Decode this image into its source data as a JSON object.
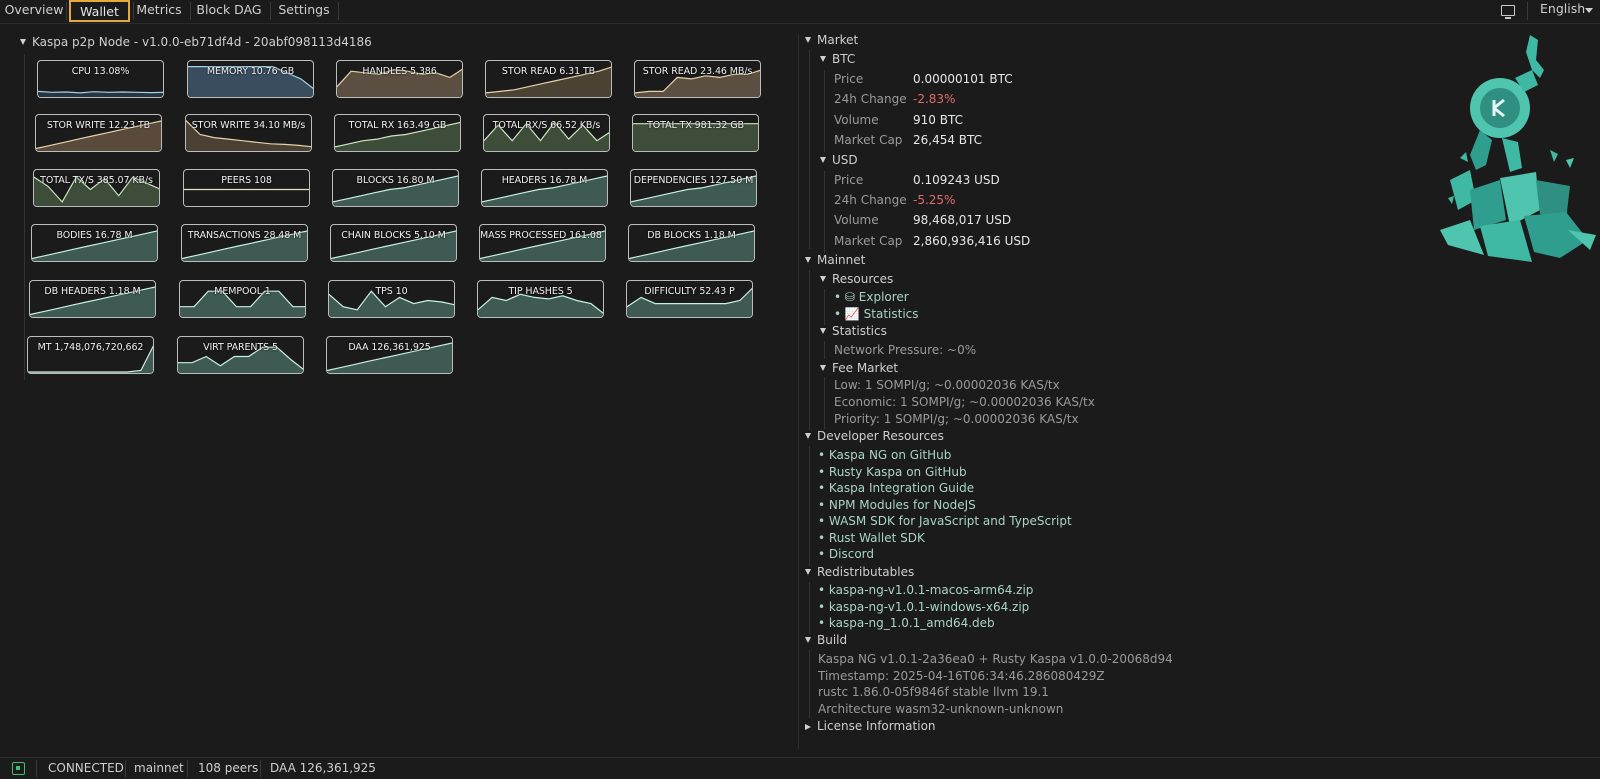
{
  "tabs": [
    {
      "label": "Overview",
      "active": false
    },
    {
      "label": "Wallet",
      "active": true
    },
    {
      "label": "Metrics",
      "active": false
    },
    {
      "label": "Block DAG",
      "active": false
    },
    {
      "label": "Settings",
      "active": false
    }
  ],
  "language": "English",
  "node_title": "Kaspa p2p Node - v1.0.0-eb71df4d - 20abf098113d4186",
  "metrics": [
    {
      "label": "CPU 13.08%",
      "fill": "#253640",
      "stroke": "#9fd2e8",
      "values": [
        0.15,
        0.12,
        0.13,
        0.1,
        0.14,
        0.12,
        0.13,
        0.12,
        0.11,
        0.12
      ]
    },
    {
      "label": "MEMORY 10.76 GB",
      "fill": "#3a4d5e",
      "stroke": "#9fd2e8",
      "values": [
        0.95,
        0.95,
        0.95,
        0.95,
        0.95,
        0.95,
        0.95,
        0.75,
        0.55,
        0.2
      ]
    },
    {
      "label": "HANDLES 5,386",
      "fill": "#5a4f40",
      "stroke": "#e8d2a8",
      "values": [
        0.3,
        0.8,
        0.75,
        0.7,
        0.85,
        0.8,
        0.7,
        0.75,
        0.6,
        0.9
      ]
    },
    {
      "label": "STOR READ 6.31 TB",
      "fill": "#4a4334",
      "stroke": "#e8d2a8",
      "values": [
        0.1,
        0.15,
        0.2,
        0.3,
        0.4,
        0.5,
        0.6,
        0.7,
        0.8,
        0.95
      ]
    },
    {
      "label": "STOR READ 23.46 MB/s",
      "fill": "#5a4f40",
      "stroke": "#e8d2a8",
      "values": [
        0.1,
        0.15,
        0.15,
        0.6,
        0.55,
        0.65,
        0.6,
        0.7,
        0.7,
        0.85
      ]
    },
    {
      "label": "STOR WRITE 12.23 TB",
      "fill": "#5a4a3c",
      "stroke": "#e8d2a8",
      "values": [
        0.05,
        0.15,
        0.25,
        0.35,
        0.45,
        0.55,
        0.65,
        0.75,
        0.85,
        0.95
      ]
    },
    {
      "label": "STOR WRITE 34.10 MB/s",
      "fill": "#4a4034",
      "stroke": "#e8d2a8",
      "values": [
        0.95,
        0.5,
        0.4,
        0.35,
        0.3,
        0.25,
        0.2,
        0.18,
        0.15,
        0.1
      ]
    },
    {
      "label": "TOTAL RX 163.49 GB",
      "fill": "#3e4d3a",
      "stroke": "#c8e8c0",
      "values": [
        0.1,
        0.2,
        0.3,
        0.35,
        0.45,
        0.5,
        0.6,
        0.7,
        0.8,
        0.9
      ]
    },
    {
      "label": "TOTAL RX/S 66.52 KB/s",
      "fill": "#3e4d3a",
      "stroke": "#c8e8c0",
      "values": [
        0.3,
        0.8,
        0.3,
        0.85,
        0.3,
        0.9,
        0.35,
        0.8,
        0.3,
        0.6
      ]
    },
    {
      "label": "TOTAL TX 981.32 GB",
      "fill": "#3e4d3a",
      "stroke": "#c8e8c0",
      "values": [
        0.85,
        0.85,
        0.85,
        0.85,
        0.85,
        0.85,
        0.85,
        0.85,
        0.85,
        0.85
      ]
    },
    {
      "label": "TOTAL TX/S 385.07 KB/s",
      "fill": "#3e4d3a",
      "stroke": "#c8e8c0",
      "values": [
        0.9,
        0.6,
        0.1,
        0.9,
        0.5,
        0.85,
        0.3,
        0.9,
        0.7,
        0.5
      ]
    },
    {
      "label": "PEERS 108",
      "fill": "#1b1b1b",
      "stroke": "#e8e0b8",
      "values": [
        0.5,
        0.5,
        0.5,
        0.5,
        0.5,
        0.5,
        0.5,
        0.5,
        0.5,
        0.5
      ]
    },
    {
      "label": "BLOCKS 16.80 M",
      "fill": "#3e5a52",
      "stroke": "#c8f0e4",
      "values": [
        0.1,
        0.2,
        0.3,
        0.4,
        0.5,
        0.55,
        0.65,
        0.75,
        0.85,
        0.95
      ]
    },
    {
      "label": "HEADERS 16.78 M",
      "fill": "#3e5a52",
      "stroke": "#c8f0e4",
      "values": [
        0.1,
        0.2,
        0.3,
        0.4,
        0.5,
        0.55,
        0.65,
        0.75,
        0.85,
        0.95
      ]
    },
    {
      "label": "DEPENDENCIES 127.50 M",
      "fill": "#3e5a52",
      "stroke": "#c8f0e4",
      "values": [
        0.1,
        0.2,
        0.3,
        0.4,
        0.5,
        0.55,
        0.65,
        0.75,
        0.85,
        0.95
      ]
    },
    {
      "label": "BODIES 16.78 M",
      "fill": "#3e5a52",
      "stroke": "#c8f0e4",
      "values": [
        0.05,
        0.15,
        0.25,
        0.35,
        0.45,
        0.55,
        0.65,
        0.75,
        0.85,
        0.95
      ]
    },
    {
      "label": "TRANSACTIONS 28.48 M",
      "fill": "#3e5a52",
      "stroke": "#c8f0e4",
      "values": [
        0.05,
        0.15,
        0.25,
        0.35,
        0.45,
        0.55,
        0.65,
        0.75,
        0.85,
        0.95
      ]
    },
    {
      "label": "CHAIN BLOCKS 5.10 M",
      "fill": "#3e5a52",
      "stroke": "#c8f0e4",
      "values": [
        0.05,
        0.15,
        0.25,
        0.35,
        0.45,
        0.55,
        0.65,
        0.75,
        0.85,
        0.95
      ]
    },
    {
      "label": "MASS PROCESSED 161.08 G",
      "fill": "#3e5a52",
      "stroke": "#c8f0e4",
      "values": [
        0.05,
        0.15,
        0.25,
        0.35,
        0.45,
        0.55,
        0.65,
        0.75,
        0.85,
        0.95
      ]
    },
    {
      "label": "DB BLOCKS 1.18 M",
      "fill": "#3e5a52",
      "stroke": "#c8f0e4",
      "values": [
        0.05,
        0.15,
        0.25,
        0.35,
        0.45,
        0.55,
        0.65,
        0.75,
        0.85,
        0.95
      ]
    },
    {
      "label": "DB HEADERS 1.18 M",
      "fill": "#3e5a52",
      "stroke": "#c8f0e4",
      "values": [
        0.05,
        0.15,
        0.25,
        0.35,
        0.45,
        0.55,
        0.65,
        0.75,
        0.85,
        0.95
      ]
    },
    {
      "label": "MEMPOOL 1",
      "fill": "#3e5a52",
      "stroke": "#c8f0e4",
      "values": [
        0.3,
        0.3,
        0.8,
        0.8,
        0.3,
        0.3,
        0.8,
        0.8,
        0.3,
        0.3
      ]
    },
    {
      "label": "TPS 10",
      "fill": "#3e5a52",
      "stroke": "#c8f0e4",
      "values": [
        0.7,
        0.3,
        0.2,
        0.8,
        0.3,
        0.6,
        0.4,
        0.5,
        0.45,
        0.35
      ]
    },
    {
      "label": "TIP HASHES 5",
      "fill": "#3e5a52",
      "stroke": "#c8f0e4",
      "values": [
        0.2,
        0.6,
        0.5,
        0.7,
        0.6,
        0.55,
        0.65,
        0.5,
        0.4,
        0.05
      ]
    },
    {
      "label": "DIFFICULTY 52.43 P",
      "fill": "#3e5a52",
      "stroke": "#c8f0e4",
      "values": [
        0.3,
        0.6,
        0.4,
        0.4,
        0.4,
        0.4,
        0.4,
        0.4,
        0.5,
        0.95
      ]
    },
    {
      "label": "MT 1,748,076,720,662",
      "fill": "#3e5a52",
      "stroke": "#c8f0e4",
      "values": [
        0,
        0,
        0,
        0,
        0,
        0,
        0,
        0,
        0.05,
        0.95
      ]
    },
    {
      "label": "VIRT PARENTS 5",
      "fill": "#3e5a52",
      "stroke": "#c8f0e4",
      "values": [
        0.3,
        0.3,
        0.5,
        0.2,
        0.5,
        0.5,
        0.8,
        0.8,
        0.4,
        0.05
      ]
    },
    {
      "label": "DAA 126,361,925",
      "fill": "#3e5a52",
      "stroke": "#c8f0e4",
      "values": [
        0.05,
        0.15,
        0.25,
        0.35,
        0.45,
        0.55,
        0.65,
        0.75,
        0.85,
        0.95
      ]
    }
  ],
  "market": {
    "title": "Market",
    "btc": {
      "title": "BTC",
      "rows": [
        {
          "label": "Price",
          "value": "0.00000101 BTC",
          "neg": false
        },
        {
          "label": "24h Change",
          "value": "-2.83%",
          "neg": true
        },
        {
          "label": "Volume",
          "value": "910 BTC",
          "neg": false
        },
        {
          "label": "Market Cap",
          "value": "26,454 BTC",
          "neg": false
        }
      ]
    },
    "usd": {
      "title": "USD",
      "rows": [
        {
          "label": "Price",
          "value": "0.109243 USD",
          "neg": false
        },
        {
          "label": "24h Change",
          "value": "-5.25%",
          "neg": true
        },
        {
          "label": "Volume",
          "value": "98,468,017 USD",
          "neg": false
        },
        {
          "label": "Market Cap",
          "value": "2,860,936,416 USD",
          "neg": false
        }
      ]
    }
  },
  "mainnet": {
    "title": "Mainnet",
    "resources_title": "Resources",
    "resources": [
      "• ⛁ Explorer",
      "• 📈 Statistics"
    ],
    "statistics_title": "Statistics",
    "network_pressure": "Network Pressure: ~0%",
    "fee_market_title": "Fee Market",
    "fees": [
      "Low: 1 SOMPI/g;  ~0.00002036 KAS/tx",
      "Economic: 1 SOMPI/g;  ~0.00002036 KAS/tx",
      "Priority: 1 SOMPI/g;  ~0.00002036 KAS/tx"
    ]
  },
  "dev": {
    "title": "Developer Resources",
    "links": [
      "• Kaspa NG on GitHub",
      "• Rusty Kaspa on GitHub",
      "• Kaspa Integration Guide",
      "• NPM Modules for NodeJS",
      "• WASM SDK for JavaScript and TypeScript",
      "• Rust Wallet SDK",
      "• Discord"
    ]
  },
  "redist": {
    "title": "Redistributables",
    "links": [
      "• kaspa-ng-v1.0.1-macos-arm64.zip",
      "• kaspa-ng-v1.0.1-windows-x64.zip",
      "• kaspa-ng_1.0.1_amd64.deb"
    ]
  },
  "build": {
    "title": "Build",
    "lines": [
      "Kaspa NG v1.0.1-2a36ea0 + Rusty Kaspa v1.0.0-20068d94",
      "Timestamp: 2025-04-16T06:34:46.286080429Z",
      "rustc 1.86.0-05f9846f stable  llvm 19.1",
      "Architecture wasm32-unknown-unknown"
    ]
  },
  "license_title": "License Information",
  "status": {
    "connection": "CONNECTED",
    "network": "mainnet",
    "peers": "108 peers",
    "daa": "DAA 126,361,925"
  },
  "colors": {
    "accent": "#e8a93a",
    "negative": "#e06c6c",
    "link": "#a8d4c8",
    "connected": "#3fbf6f"
  }
}
